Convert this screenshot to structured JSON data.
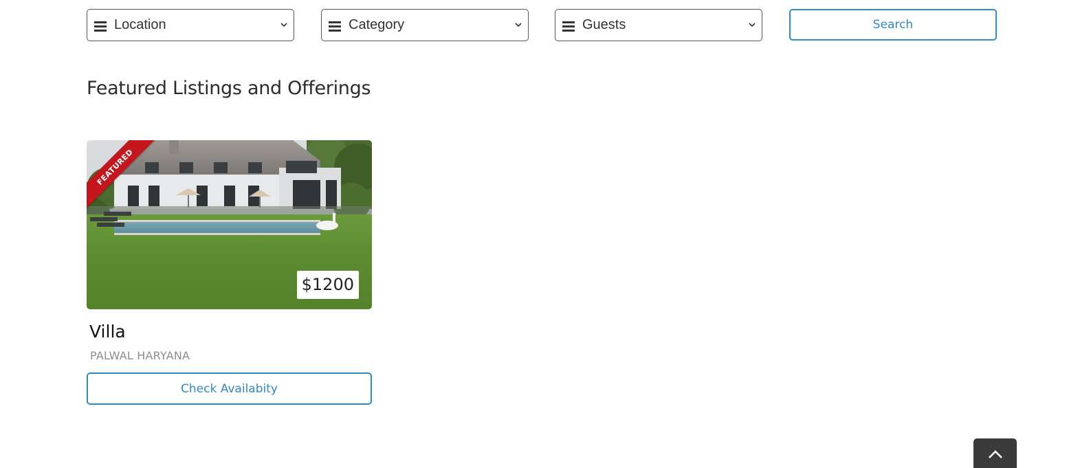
{
  "filters": {
    "location": {
      "label": "Location",
      "icon": "menu-bars-icon"
    },
    "category": {
      "label": "Category",
      "icon": "menu-bars-icon"
    },
    "guests": {
      "label": "Guests",
      "icon": "menu-bars-icon"
    }
  },
  "search": {
    "label": "Search"
  },
  "section": {
    "title": "Featured Listings and Offerings"
  },
  "listing": {
    "badge": "FEATURED",
    "price": "$1200",
    "title": "Villa",
    "location": "PALWAL HARYANA",
    "cta": "Check Availabity",
    "image": "villa-with-pool-photo"
  },
  "back_to_top": {
    "icon": "chevron-up-icon"
  },
  "colors": {
    "accent": "#2e8bc9",
    "badge": "#c4161c",
    "heading": "#2b2b2b",
    "muted": "#8c8c8c",
    "to_top_bg": "#3a3a3a"
  }
}
